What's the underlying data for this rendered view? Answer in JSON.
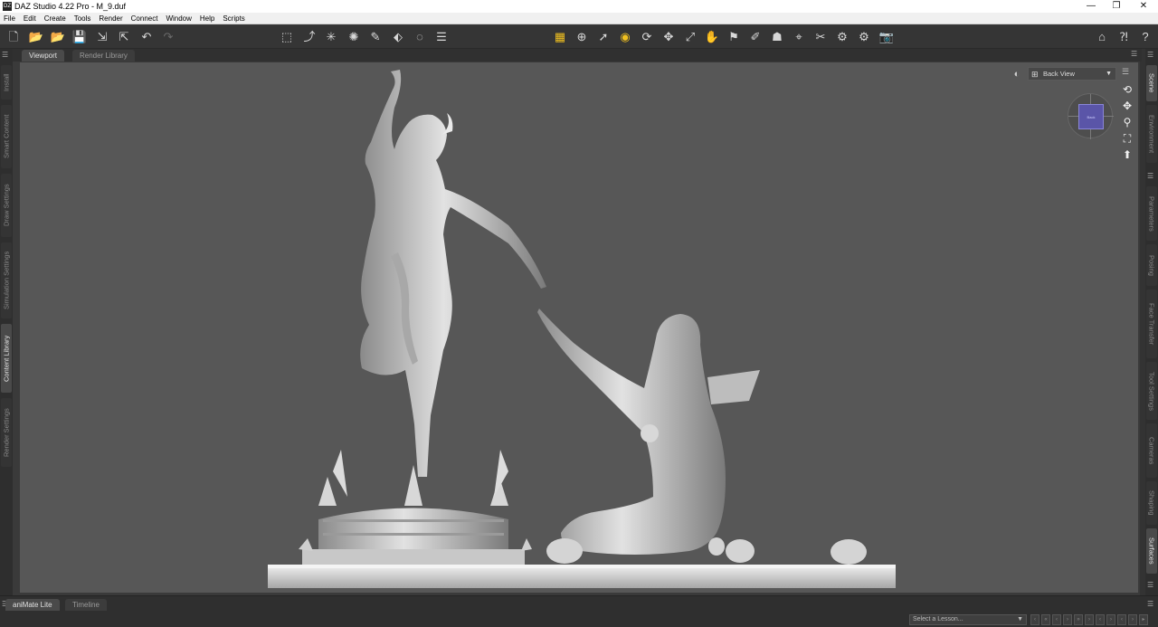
{
  "window": {
    "title": "DAZ Studio 4.22 Pro - M_9.duf",
    "app_icon": "daz-icon",
    "controls": [
      "—",
      "❐",
      "✕"
    ]
  },
  "menu": [
    "File",
    "Edit",
    "Create",
    "Tools",
    "Render",
    "Connect",
    "Window",
    "Help",
    "Scripts"
  ],
  "tabs": {
    "viewport": "Viewport",
    "render_library": "Render Library"
  },
  "left_panels": [
    "Install",
    "Smart Content",
    "Draw Settings",
    "Simulation Settings",
    "Content Library",
    "Render Settings"
  ],
  "right_panels": [
    "Scene",
    "Environment",
    "Parameters",
    "Posing",
    "Face Transfer",
    "Tool Settings",
    "Cameras",
    "Shaping",
    "Surfaces"
  ],
  "viewport": {
    "view_select": "Back View",
    "navcube_label": "Back"
  },
  "bottom_tabs": {
    "animate": "aniMate Lite",
    "timeline": "Timeline"
  },
  "lesson": {
    "placeholder": "Select a Lesson..."
  },
  "colors": {
    "active_tool": "#f0c020",
    "viewport_bg": "#575757",
    "navcube": "#5a55a8"
  }
}
